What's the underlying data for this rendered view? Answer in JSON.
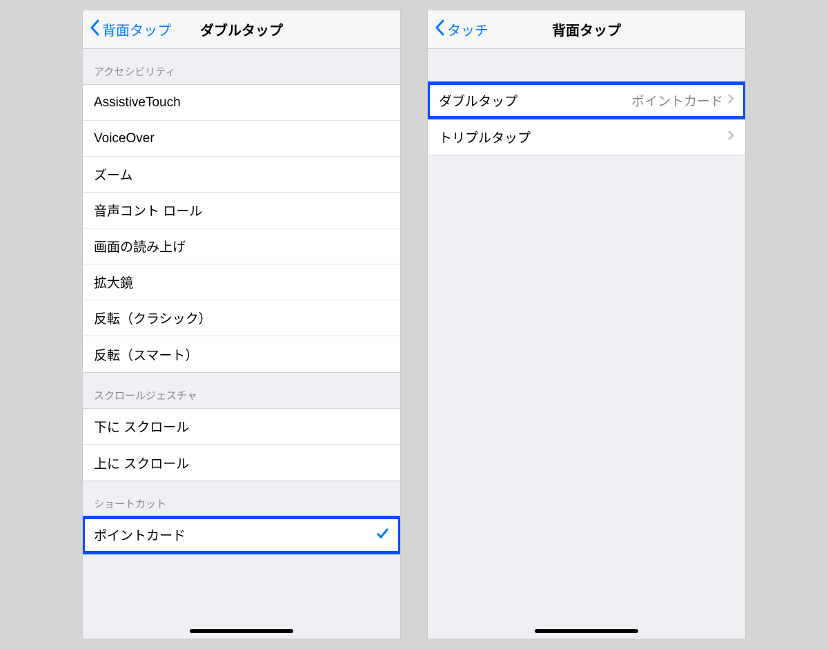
{
  "left": {
    "nav": {
      "back": "背面タップ",
      "title": "ダブルタップ"
    },
    "sections": {
      "accessibility": {
        "header": "アクセシビリティ",
        "items": [
          "AssistiveTouch",
          "VoiceOver",
          "ズーム",
          "音声コント ロール",
          "画面の読み上げ",
          "拡大鏡",
          "反転（クラシック）",
          "反転（スマート）"
        ]
      },
      "scroll": {
        "header": "スクロールジェスチャ",
        "items": [
          "下に スクロール",
          "上に スクロール"
        ]
      },
      "shortcut": {
        "header": "ショートカット",
        "items": [
          "ポイントカード"
        ]
      }
    }
  },
  "right": {
    "nav": {
      "back": "タッチ",
      "title": "背面タップ"
    },
    "rows": {
      "double": {
        "label": "ダブルタップ",
        "value": "ポイントカード"
      },
      "triple": {
        "label": "トリプルタップ"
      }
    }
  }
}
